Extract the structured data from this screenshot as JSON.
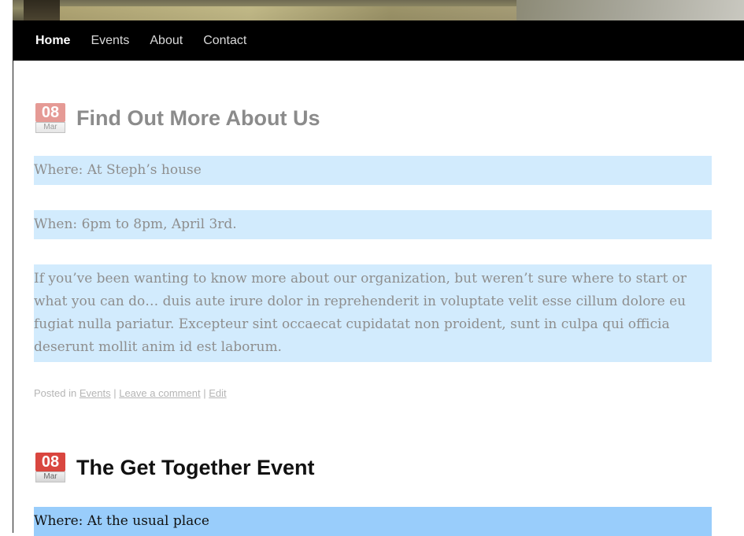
{
  "nav": {
    "items": [
      {
        "label": "Home",
        "active": true
      },
      {
        "label": "Events",
        "active": false
      },
      {
        "label": "About",
        "active": false
      },
      {
        "label": "Contact",
        "active": false
      }
    ]
  },
  "posts": [
    {
      "date_day": "08",
      "date_month": "Mar",
      "title": "Find Out More About Us",
      "where": "Where: At Steph’s house",
      "when": "When: 6pm to 8pm, April 3rd.",
      "body": "If you’ve been wanting to know more about our organization, but weren’t sure where to start or what you can do… duis aute irure dolor in reprehenderit in voluptate velit esse cillum dolore eu fugiat nulla pariatur. Excepteur sint occaecat cupidatat non proident, sunt in culpa qui officia deserunt mollit anim id est laborum.",
      "meta": {
        "posted_in": "Posted in",
        "category": "Events",
        "sep1": "|",
        "comment": "Leave a comment",
        "sep2": "|",
        "edit": "Edit"
      },
      "highlight_color": "#d2ebfd"
    },
    {
      "date_day": "08",
      "date_month": "Mar",
      "title": "The Get Together Event",
      "where": "Where: At the usual place",
      "highlight_color": "#99cdfb"
    }
  ],
  "colors": {
    "nav_bg": "#000000",
    "date_red": "#d9463f"
  }
}
